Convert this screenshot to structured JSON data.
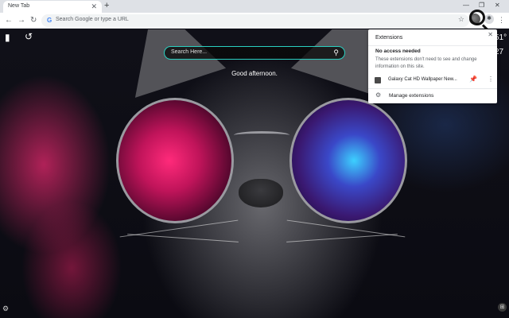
{
  "tab": {
    "title": "New Tab",
    "close_glyph": "✕",
    "new_tab_glyph": "+"
  },
  "window": {
    "minimize": "—",
    "restore": "❐",
    "close": "✕"
  },
  "toolbar": {
    "back": "←",
    "forward": "→",
    "reload": "↻",
    "omnibox_placeholder": "Search Google or type a URL",
    "google_glyph": "G",
    "star_glyph": "☆",
    "puzzle_glyph": "✱",
    "menu_glyph": "⋮"
  },
  "page": {
    "search_placeholder": "Search Here...",
    "search_glyph": "⚲",
    "greeting": "Good afternoon.",
    "weather_temp": "51°",
    "weather_num": "27",
    "bookmark_glyph": "▮",
    "history_glyph": "↺",
    "settings_glyph": "⚙",
    "grid_glyph": "⊞"
  },
  "extensions_popup": {
    "title": "Extensions",
    "close_glyph": "✕",
    "section_title": "No access needed",
    "section_desc": "These extensions don't need to see and change information on this site.",
    "items": [
      {
        "name": "Galaxy Cat HD Wallpaper New...",
        "pin_glyph": "📌",
        "menu_glyph": "⋮"
      }
    ],
    "manage_label": "Manage extensions",
    "manage_glyph": "⚙"
  },
  "colors": {
    "search_border": "#2ad0c0",
    "pin": "#1a73e8"
  },
  "icons": [
    "search-icon",
    "star-icon",
    "puzzle-icon",
    "gear-icon",
    "pin-icon",
    "bookmark-icon",
    "history-icon",
    "grid-icon",
    "magnifier-cursor-icon"
  ]
}
